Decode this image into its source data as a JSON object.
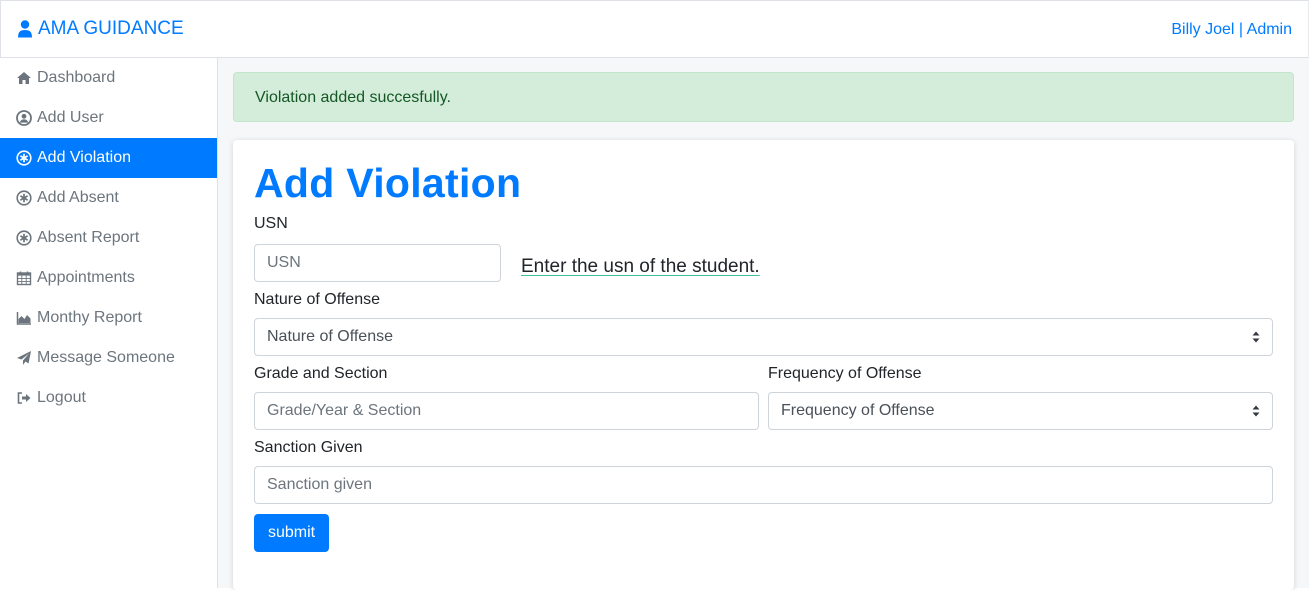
{
  "header": {
    "brand": "AMA GUIDANCE",
    "brand_icon": "user-icon",
    "user": "Billy Joel | Admin",
    "accent_color": "#007bff"
  },
  "sidebar": {
    "items": [
      {
        "label": "Dashboard",
        "icon": "home-icon",
        "active": false
      },
      {
        "label": "Add User",
        "icon": "user-circle-icon",
        "active": false
      },
      {
        "label": "Add Violation",
        "icon": "asterisk-circle-icon",
        "active": true
      },
      {
        "label": "Add Absent",
        "icon": "asterisk-circle-icon",
        "active": false
      },
      {
        "label": "Absent Report",
        "icon": "asterisk-circle-icon",
        "active": false
      },
      {
        "label": "Appointments",
        "icon": "calendar-icon",
        "active": false
      },
      {
        "label": "Monthy Report",
        "icon": "area-chart-icon",
        "active": false
      },
      {
        "label": "Message Someone",
        "icon": "paper-plane-icon",
        "active": false
      },
      {
        "label": "Logout",
        "icon": "sign-out-icon",
        "active": false
      }
    ]
  },
  "alert": {
    "message": "Violation added succesfully.",
    "color": "#d4edda"
  },
  "form": {
    "title": "Add Violation",
    "usn": {
      "label": "USN",
      "placeholder": "USN",
      "hint": "Enter the usn of the student."
    },
    "nature": {
      "label": "Nature of Offense",
      "selected": "Nature of Offense"
    },
    "grade": {
      "label": "Grade and Section",
      "placeholder": "Grade/Year & Section"
    },
    "frequency": {
      "label": "Frequency of Offense",
      "selected": "Frequency of Offense"
    },
    "sanction": {
      "label": "Sanction Given",
      "placeholder": "Sanction given"
    },
    "submit_label": "submit"
  }
}
